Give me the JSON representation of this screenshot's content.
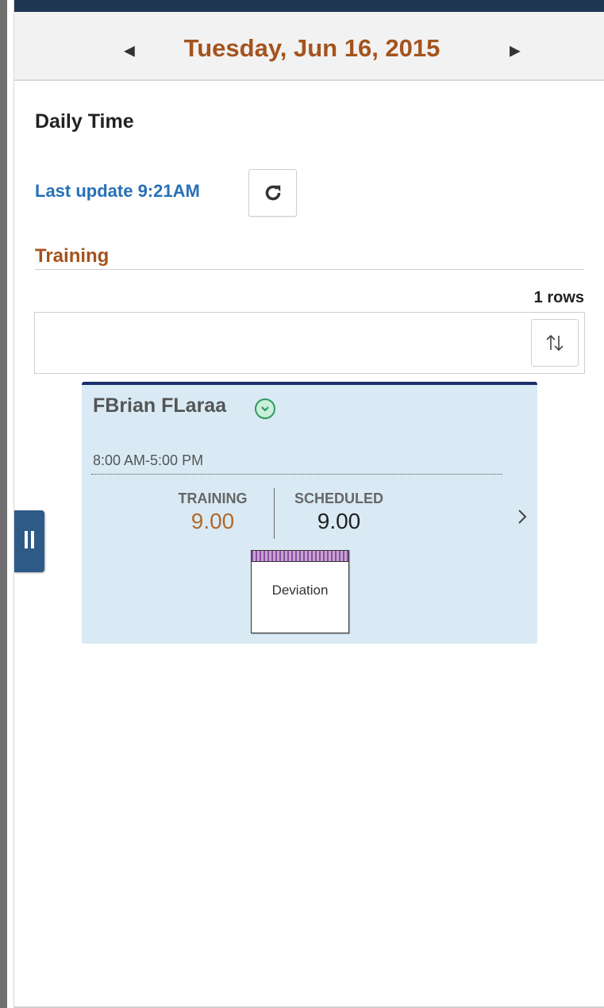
{
  "header": {
    "date": "Tuesday, Jun 16, 2015",
    "prev_icon": "triangle-left-icon",
    "next_icon": "triangle-right-icon"
  },
  "page": {
    "title": "Daily Time",
    "last_update": "Last update 9:21AM",
    "refresh_icon": "refresh-icon"
  },
  "section": {
    "title": "Training",
    "row_count": "1 rows",
    "sort_icon": "sort-icon"
  },
  "card": {
    "name": "FBrian FLaraa",
    "status_icon": "chevron-down-circle-icon",
    "time_range": "8:00 AM-5:00 PM",
    "training_label": "TRAINING",
    "training_value": "9.00",
    "scheduled_label": "SCHEDULED",
    "scheduled_value": "9.00",
    "deviation_label": "Deviation",
    "chevron_icon": "chevron-right-icon"
  },
  "side_tab": {
    "icon": "pause-icon"
  },
  "colors": {
    "accent_orange": "#a4531d",
    "link_blue": "#2770b7",
    "card_bg": "#d9eaf5",
    "card_top_border": "#1a2e6a",
    "side_tab": "#2d5a86"
  }
}
